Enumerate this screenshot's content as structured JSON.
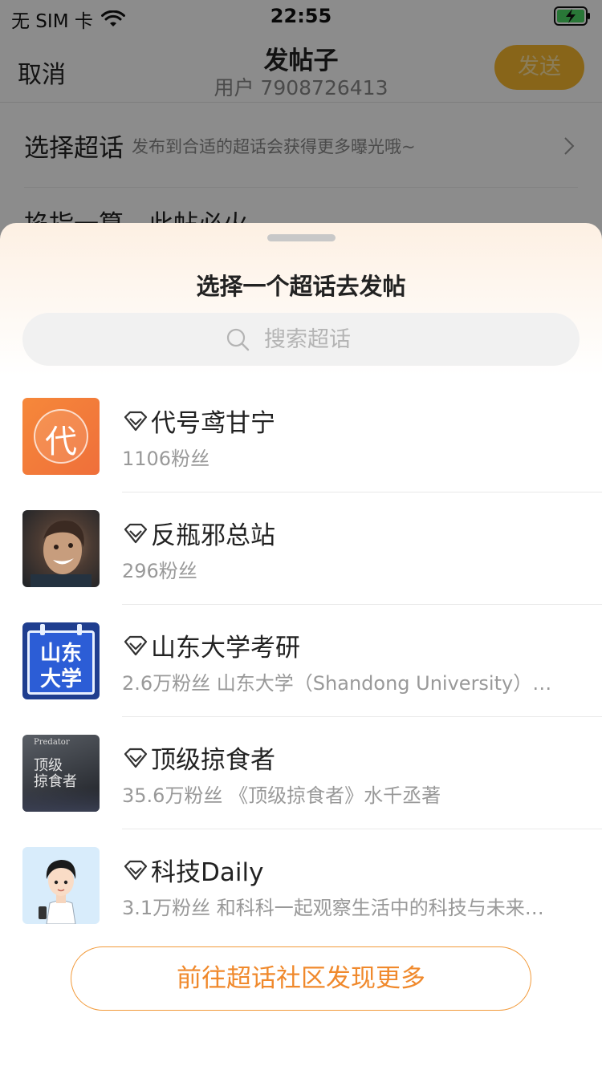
{
  "status_bar": {
    "carrier": "无 SIM 卡",
    "time": "22:55"
  },
  "nav": {
    "cancel": "取消",
    "title": "发帖子",
    "subtitle": "用户 7908726413",
    "send": "发送"
  },
  "compose": {
    "topic_label": "选择超话",
    "topic_hint": "发布到合适的超话会获得更多曝光哦~",
    "body_text": "掐指一算，此帖必火"
  },
  "sheet": {
    "title": "选择一个超话去发帖",
    "search_placeholder": "搜索超话",
    "items": [
      {
        "name": "代号鸢甘宁",
        "sub": "1106粉丝",
        "avatar_char": "代"
      },
      {
        "name": "反瓶邪总站",
        "sub": "296粉丝"
      },
      {
        "name": "山东大学考研",
        "sub": "2.6万粉丝 山东大学（Shandong University）…",
        "avatar_line1": "山东",
        "avatar_line2": "大学"
      },
      {
        "name": "顶级掠食者",
        "sub": "35.6万粉丝 《顶级掠食者》水千丞著",
        "avatar_en": "Predator",
        "avatar_line1": "顶级",
        "avatar_line2": "掠食者"
      },
      {
        "name": "科技Daily",
        "sub": "3.1万粉丝 和科科一起观察生活中的科技与未来…"
      }
    ],
    "more_button": "前往超话社区发现更多"
  },
  "colors": {
    "accent": "#f0892c",
    "send_button": "#f7b92f"
  },
  "icons": [
    "wifi-icon",
    "battery-charging-icon",
    "chevron-right-icon",
    "search-icon",
    "diamond-icon"
  ]
}
